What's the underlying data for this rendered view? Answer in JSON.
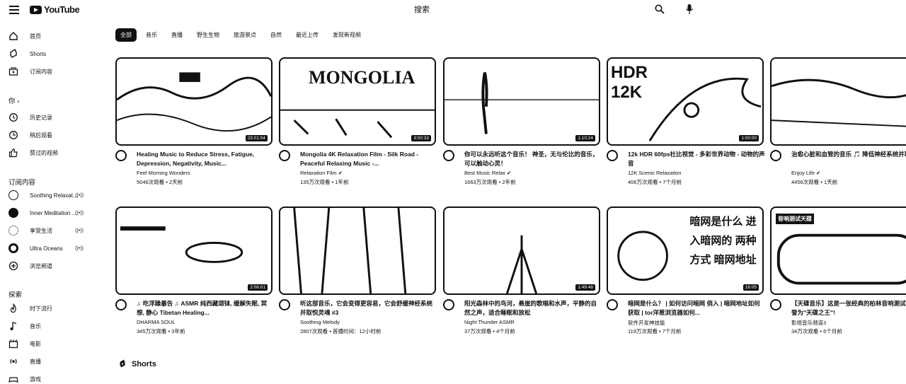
{
  "header": {
    "logo_text": "YouTube",
    "search_placeholder": "搜索"
  },
  "sidebar": {
    "main": [
      {
        "label": "首页",
        "icon": "home-icon"
      },
      {
        "label": "Shorts",
        "icon": "shorts-icon"
      },
      {
        "label": "订阅内容",
        "icon": "subscriptions-icon"
      }
    ],
    "you_section": "你 ›",
    "you": [
      {
        "label": "历史记录",
        "icon": "history-icon"
      },
      {
        "label": "稍后观看",
        "icon": "clock-icon"
      },
      {
        "label": "赞过的视频",
        "icon": "thumbs-up-icon"
      }
    ],
    "subs_section": "订阅内容",
    "subscriptions": [
      {
        "label": "Soothing Relaxat...",
        "live": "((•))"
      },
      {
        "label": "Inner Meditation ...",
        "live": "((•))"
      },
      {
        "label": "享受生活",
        "live": "((•))"
      },
      {
        "label": "Ultra Oceans",
        "live": "((•))"
      },
      {
        "label": "浏览频道",
        "live": ""
      }
    ],
    "explore_section": "探索",
    "explore": [
      {
        "label": "时下流行",
        "icon": "trending-icon"
      },
      {
        "label": "音乐",
        "icon": "music-icon"
      },
      {
        "label": "电影",
        "icon": "movie-icon"
      },
      {
        "label": "直播",
        "icon": "live-icon"
      },
      {
        "label": "游戏",
        "icon": "gaming-icon"
      }
    ]
  },
  "chips": [
    "全部",
    "音乐",
    "直播",
    "野生生物",
    "旅游景点",
    "自然",
    "最近上传",
    "发现新视频"
  ],
  "videos": [
    {
      "title": "Healing Music to Reduce Stress, Fatigue, Depression, Negativity, Music...",
      "channel": "Feel Morning Wonders",
      "stats": "5046次观看 • 2天前",
      "duration": "23:01:04",
      "overlay": ""
    },
    {
      "title": "Mongolia 4K Relaxation Film - Silk Road - Peaceful Relaxing Music -...",
      "channel": "Relaxation Film ✔",
      "stats": "135万次观看 • 1年前",
      "duration": "3:00:33",
      "overlay": "MONGOLIA"
    },
    {
      "title": "你可以永远听这个音乐！ 神圣，无与伦比的音乐，可以触动心灵！",
      "channel": "Best Music Relax ✔",
      "stats": "1663万次观看 • 2年前",
      "duration": "1:10:24",
      "overlay": ""
    },
    {
      "title": "12k HDR 60fps杜比视觉 - 多彩世界动物 - 动物的声音",
      "channel": "12K Scenic Relaxation",
      "stats": "406万次观看 • 7个月前",
      "duration": "1:00:00",
      "overlay": "HDR 12K"
    },
    {
      "title": "治愈心脏和血管的音乐 🎵 降低神经系统并取悦灵魂",
      "channel": "Enjoy Life ✔",
      "stats": "4456次观看 • 1天前",
      "duration": "",
      "overlay": ""
    },
    {
      "title": "♫ 吃浮躁暴告 ♫ ASMR 纯西藏颂钵, 缓解失眠, 冥想, 静心 Tibetan Healing...",
      "channel": "DHARMA SOUL",
      "stats": "345万次观看 • 3年前",
      "duration": "2:06:01",
      "overlay": ""
    },
    {
      "title": "听这部音乐，它会变得更容易，它会舒缓神经系统并取悦灵魂 #3",
      "channel": "Soothing Melody",
      "stats": "2807次观看 • 首播时间：12小时前",
      "duration": "",
      "overlay": ""
    },
    {
      "title": "阳光森林中的鸟河，悬崖的歌唱和水声，平静的自然之声，适合睡眠和放松",
      "channel": "Night Thunder ASMR",
      "stats": "37万次观看 • 4个月前",
      "duration": "1:49:48",
      "overlay": ""
    },
    {
      "title": "暗网是什么？ | 如何访问暗网 俏入 | 暗网地址如何获取 | tor洋葱浏览器如何...",
      "channel": "软件开发神技能",
      "stats": "119万次观看 • 7个月前",
      "duration": "16:05",
      "overlay": "暗网是什么 进入暗网的 两种方式 暗网地址"
    },
    {
      "title": "【天碟音乐】这是一张经典的柏林音响测试碟，被誉为\"天碟之王\"!",
      "channel": "影视音乐频道3",
      "stats": "34万次观看 • 6个月前",
      "duration": "",
      "overlay": "音响测试天碟"
    }
  ],
  "shorts_title": "Shorts"
}
